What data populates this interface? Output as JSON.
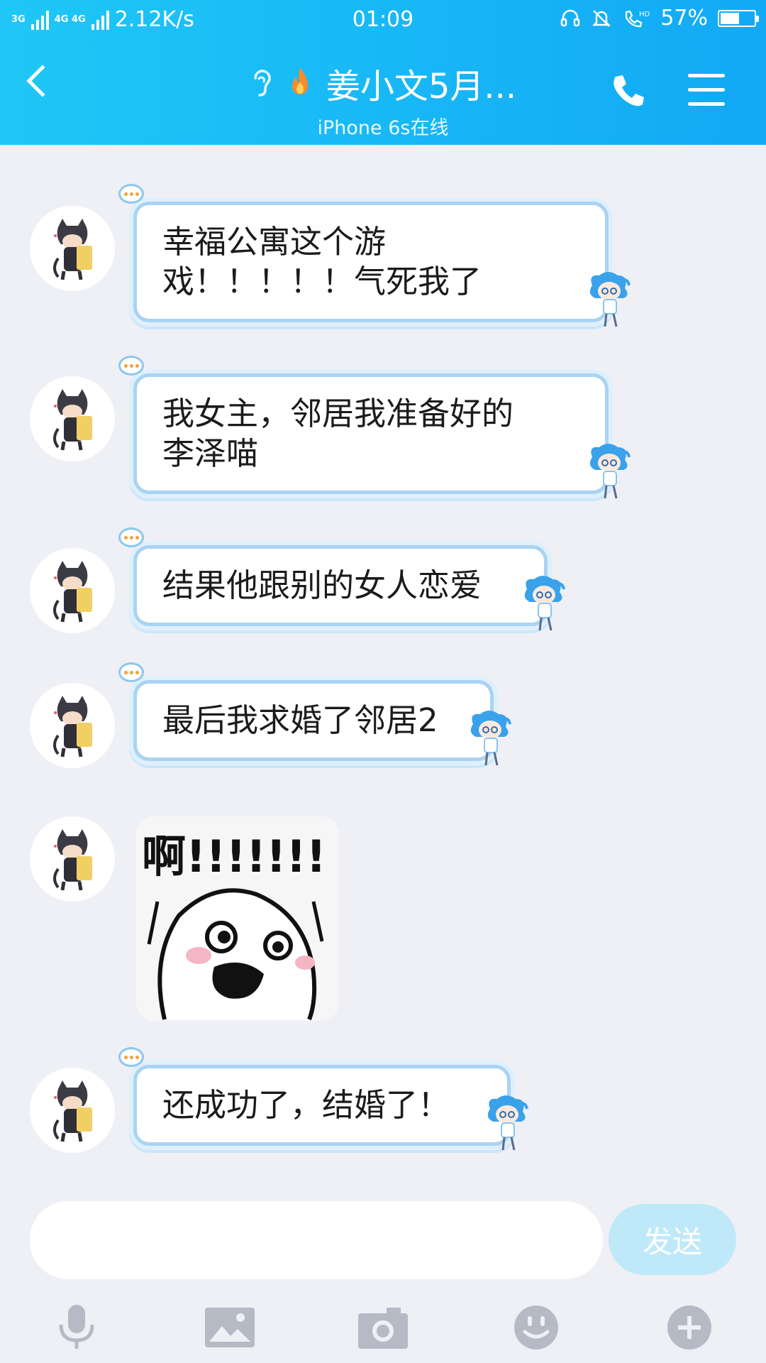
{
  "status_bar": {
    "signal1_tag": "3G",
    "signal2_tag": "4G 4G",
    "network_speed": "2.12K/s",
    "time": "01:09",
    "battery_percent": "57%",
    "battery_level": 0.57
  },
  "header": {
    "title": "姜小文5月...",
    "subtitle": "iPhone 6s在线",
    "icons": [
      "back-icon",
      "ear-icon",
      "fire-icon",
      "phone-icon",
      "menu-icon"
    ]
  },
  "messages": [
    {
      "type": "text",
      "text": "幸福公寓这个游\n戏！！！！！气死我了"
    },
    {
      "type": "text",
      "text": "我女主，邻居我准备好的\n李泽喵"
    },
    {
      "type": "text",
      "text": "结果他跟别的女人恋爱"
    },
    {
      "type": "text",
      "text": "最后我求婚了邻居2"
    },
    {
      "type": "sticker",
      "caption": "啊!!!!!!!"
    },
    {
      "type": "text",
      "text": "还成功了，结婚了！"
    }
  ],
  "composer": {
    "input_value": "",
    "send_label": "发送"
  },
  "toolbar_icons": [
    "mic-icon",
    "image-icon",
    "camera-icon",
    "emoji-icon",
    "plus-icon"
  ],
  "colors": {
    "header_start": "#1fc7f6",
    "header_end": "#12a9f5",
    "background": "#eef0f6",
    "bubble_border": "#a9d3f3",
    "send_button": "#bfe9f8",
    "toolbar_icon": "#b5bac4"
  }
}
